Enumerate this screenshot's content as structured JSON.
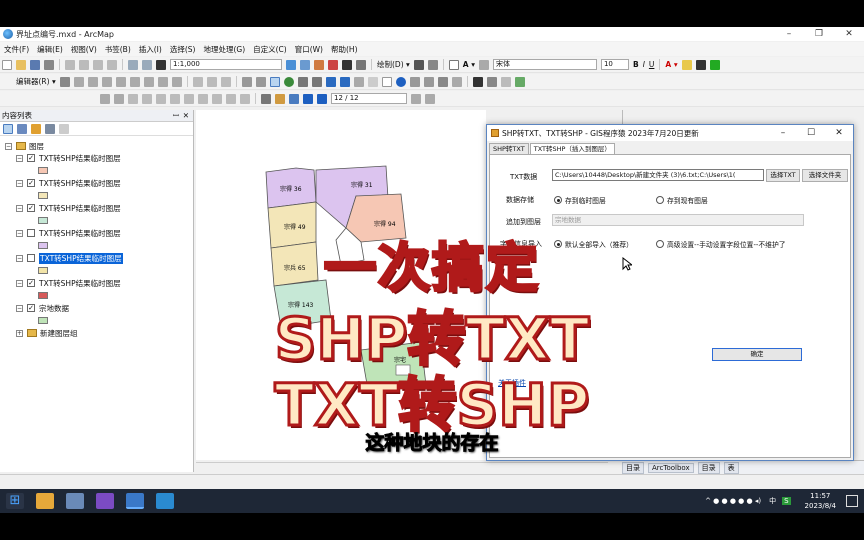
{
  "window": {
    "title": "界址点编号.mxd - ArcMap"
  },
  "menu": [
    "文件(F)",
    "编辑(E)",
    "视图(V)",
    "书签(B)",
    "插入(I)",
    "选择(S)",
    "地理处理(G)",
    "自定义(C)",
    "窗口(W)",
    "帮助(H)"
  ],
  "toolbar": {
    "scale": "1:1,000",
    "drawing_label": "绘制(D) ▾",
    "font_name": "宋体",
    "font_size": "10",
    "editor_label": "编辑器(R) ▾",
    "page_field": "12 / 12"
  },
  "toc": {
    "title": "内容列表",
    "group": "图层",
    "layers": [
      {
        "label": "TXT转SHP结果临时图层",
        "checked": true,
        "swatch": "#f6c7b4"
      },
      {
        "label": "TXT转SHP结果临时图层",
        "checked": true,
        "swatch": "#f3e6b8"
      },
      {
        "label": "TXT转SHP结果临时图层",
        "checked": true,
        "swatch": "#c6e8d6"
      },
      {
        "label": "TXT转SHP结果临时图层",
        "checked": false,
        "swatch": "#dcc4ef"
      },
      {
        "label": "TXT转SHP结果临时图层",
        "checked": false,
        "swatch": "#f2e4a8",
        "selected": true
      },
      {
        "label": "TXT转SHP结果临时图层",
        "checked": true,
        "swatch": "#d65a5a"
      },
      {
        "label": "宗地数据",
        "checked": true,
        "swatch": "#bfe4b8"
      }
    ],
    "extra_group": "新建图层组"
  },
  "map": {
    "parcels": [
      "宗得 36",
      "宗得 31",
      "宗得 49",
      "宗得 94",
      "宗兵 65",
      "宗得 143",
      "宗宅"
    ]
  },
  "dialog": {
    "title": "SHP转TXT、TXT转SHP - GIS程序猿  2023年7月20日更新",
    "tabs": [
      "SHP转TXT",
      "TXT转SHP（插入到图层）"
    ],
    "txt_label": "TXT数据",
    "txt_path": "C:\\Users\\10448\\Desktop\\新建文件夹 (3)\\6.txt;C:\\Users\\1(",
    "select_txt": "选择TXT",
    "select_folder": "选择文件夹",
    "storage_label": "数据存储",
    "storage_opt1": "存到临时图层",
    "storage_opt2": "存到现有图层",
    "append_label": "追加到图层",
    "append_value": "宗地数据",
    "field_label": "字段信息导入",
    "field_opt1": "默认全部导入（推荐）",
    "field_opt2": "高级设置--手动设置字段位置--不维护了",
    "ok": "确定",
    "about": "关于插件"
  },
  "dock": {
    "tabs": [
      "目录",
      "ArcToolbox",
      "目录",
      "表"
    ]
  },
  "overlay": {
    "line1": "一次搞定",
    "line2": "SHP转TXT",
    "line3": "TXT转SHP",
    "subtitle": "这种地块的存在"
  },
  "taskbar": {
    "time": "11:57",
    "date": "2023/8/4",
    "lang": "中",
    "input": "S"
  }
}
